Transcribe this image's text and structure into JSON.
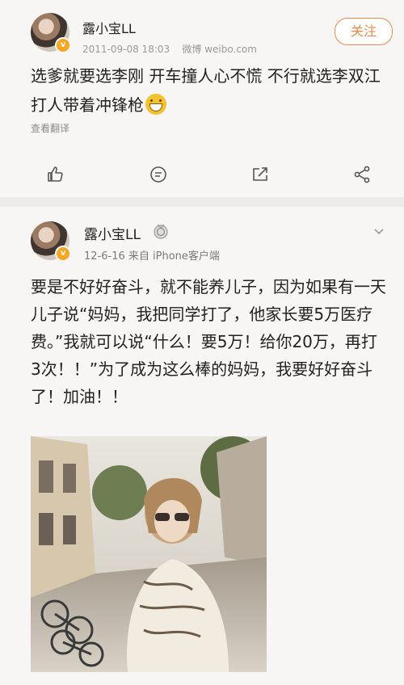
{
  "post1": {
    "user_name": "露小宝LL",
    "date": "2011-09-08 18:03",
    "source": "微博 weibo.com",
    "follow_label": "关注",
    "text": "选爹就要选李刚 开车撞人心不慌 不行就选李双江 打人带着冲锋枪",
    "emoji": "grinning-face-icon",
    "translate_label": "查看翻译",
    "actions": [
      "like-icon",
      "comment-icon",
      "repost-icon",
      "share-icon"
    ]
  },
  "post2": {
    "user_name": "露小宝LL",
    "meta": "12-6-16  来自 iPhone客户端",
    "text": "要是不好好奋斗，就不能养儿子，因为如果有一天儿子说“妈妈，我把同学打了，他家长要5万医疗费。”我就可以说“什么！要5万！给你20万，再打3次！！”为了成为这么棒的妈妈，我要好好奋斗了！加油！！",
    "photo": "street-photo-woman-sunglasses"
  },
  "colors": {
    "accent": "#e88a50",
    "badge": "#f5a623",
    "background": "#ecebe9",
    "card": "#f7f6f4"
  }
}
